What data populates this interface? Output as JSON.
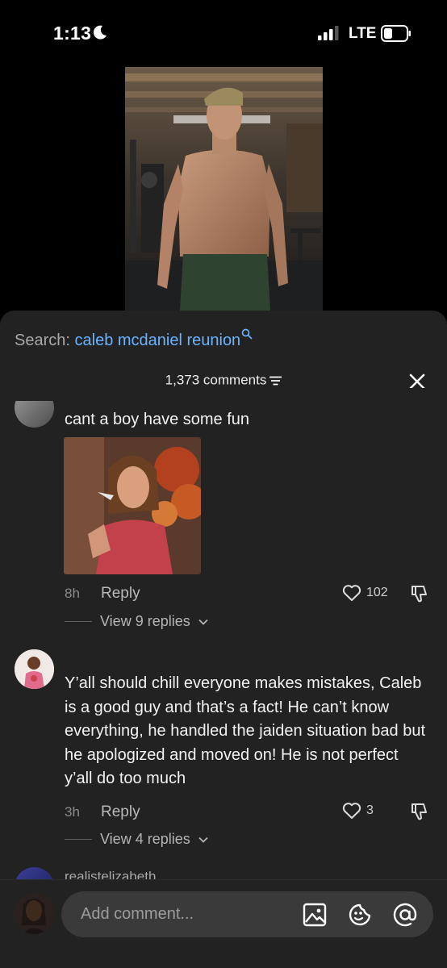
{
  "status_bar": {
    "time": "1:13",
    "network": "LTE"
  },
  "search": {
    "prefix": "Search:",
    "query": "caleb mcdaniel reunion"
  },
  "comments_header": {
    "count_label": "1,373 comments"
  },
  "comments": [
    {
      "partial_name": "",
      "text": "cant a boy have some fun",
      "has_gif": true,
      "age": "8h",
      "reply_label": "Reply",
      "likes": "102",
      "view_replies": "View 9 replies"
    },
    {
      "text": "Y’all should chill everyone makes mistakes, Caleb is a good guy and that’s a fact! He can’t know everything, he handled the jaiden situation bad but he apologized and moved on! He is not perfect y’all do too much",
      "age": "3h",
      "reply_label": "Reply",
      "likes": "3",
      "view_replies": "View 4 replies"
    },
    {
      "username": "realistelizabeth"
    }
  ],
  "composer": {
    "placeholder": "Add comment..."
  },
  "colors": {
    "link_blue": "#6ab4ff",
    "sheet_bg": "#222222",
    "pill_bg": "#3a3a3a"
  }
}
